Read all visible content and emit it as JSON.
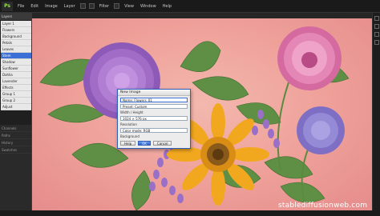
{
  "menubar": {
    "logo": "Ps",
    "items": [
      "File",
      "Edit",
      "Image",
      "Layer",
      "Filter",
      "View",
      "Window",
      "Help"
    ]
  },
  "left_panel": {
    "header": "Layers",
    "rows": [
      "Layer 1",
      "Flowers",
      "Background",
      "Petals",
      "Leaves",
      "Stem",
      "Shadow",
      "Sunflower",
      "Dahlia",
      "Lavender",
      "Effects",
      "Group 1",
      "Group 2",
      "Adjust"
    ],
    "selected_index": 5,
    "lower_rows": [
      "Channels",
      "Paths",
      "History",
      "Swatches"
    ]
  },
  "dialog": {
    "title": "New Image",
    "field1": "Name: Flowers_01",
    "field2": "Preset: Custom",
    "label1": "Width / Height",
    "field3": "1024 × 576 px",
    "label2": "Resolution",
    "field4": "Color mode: RGB",
    "label3": "Background",
    "ok": "OK",
    "cancel": "Cancel",
    "help": "Help"
  },
  "watermark": "stablediffusionweb.com",
  "colors": {
    "canvas_bg": "#ee9f98",
    "accent": "#3b6fd6"
  }
}
